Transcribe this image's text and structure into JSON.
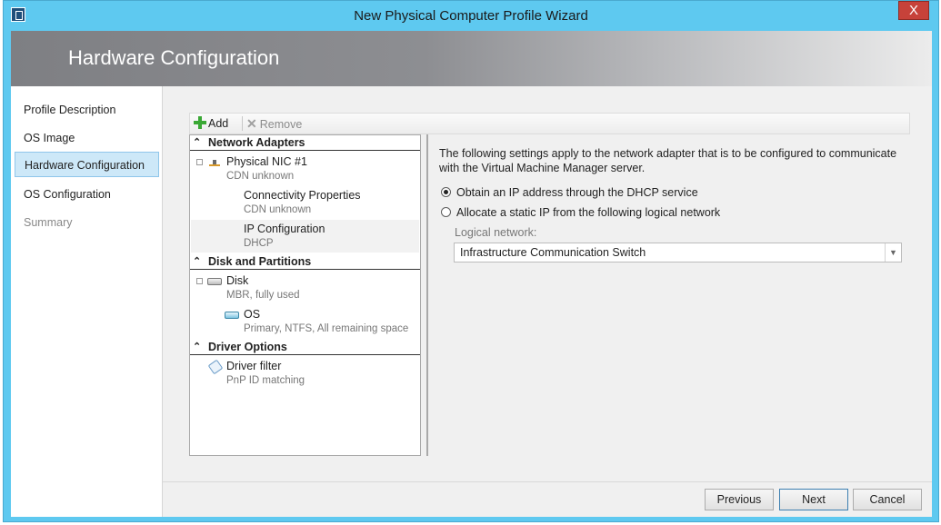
{
  "window": {
    "title": "New Physical Computer Profile Wizard",
    "close_glyph": "X"
  },
  "banner": {
    "title": "Hardware Configuration"
  },
  "nav": {
    "items": [
      {
        "label": "Profile Description",
        "state": "normal"
      },
      {
        "label": "OS Image",
        "state": "normal"
      },
      {
        "label": "Hardware Configuration",
        "state": "selected"
      },
      {
        "label": "OS Configuration",
        "state": "normal"
      },
      {
        "label": "Summary",
        "state": "disabled"
      }
    ]
  },
  "toolbar": {
    "add_label": "Add",
    "remove_label": "Remove"
  },
  "tree": {
    "sections": [
      {
        "title": "Network Adapters",
        "items": [
          {
            "label": "Physical NIC #1",
            "sub": "CDN unknown",
            "icon": "network-adapter-icon"
          },
          {
            "label": "Connectivity Properties",
            "sub": "CDN unknown"
          },
          {
            "label": "IP Configuration",
            "sub": "DHCP",
            "selected": true
          }
        ]
      },
      {
        "title": "Disk and Partitions",
        "items": [
          {
            "label": "Disk",
            "sub": "MBR, fully used",
            "icon": "disk-icon"
          },
          {
            "label": "OS",
            "sub": "Primary, NTFS, All remaining space",
            "icon": "volume-icon"
          }
        ]
      },
      {
        "title": "Driver Options",
        "items": [
          {
            "label": "Driver filter",
            "sub": "PnP ID matching",
            "icon": "tag-icon"
          }
        ]
      }
    ]
  },
  "details": {
    "description": "The following settings apply to the network adapter that is to be configured to communicate with the Virtual Machine Manager server.",
    "options": [
      {
        "label": "Obtain an IP address through the DHCP service",
        "checked": true
      },
      {
        "label": "Allocate a static IP from the following logical network",
        "checked": false
      }
    ],
    "logical_network_label": "Logical network:",
    "logical_network_value": "Infrastructure Communication Switch"
  },
  "footer": {
    "previous": "Previous",
    "next": "Next",
    "cancel": "Cancel"
  }
}
